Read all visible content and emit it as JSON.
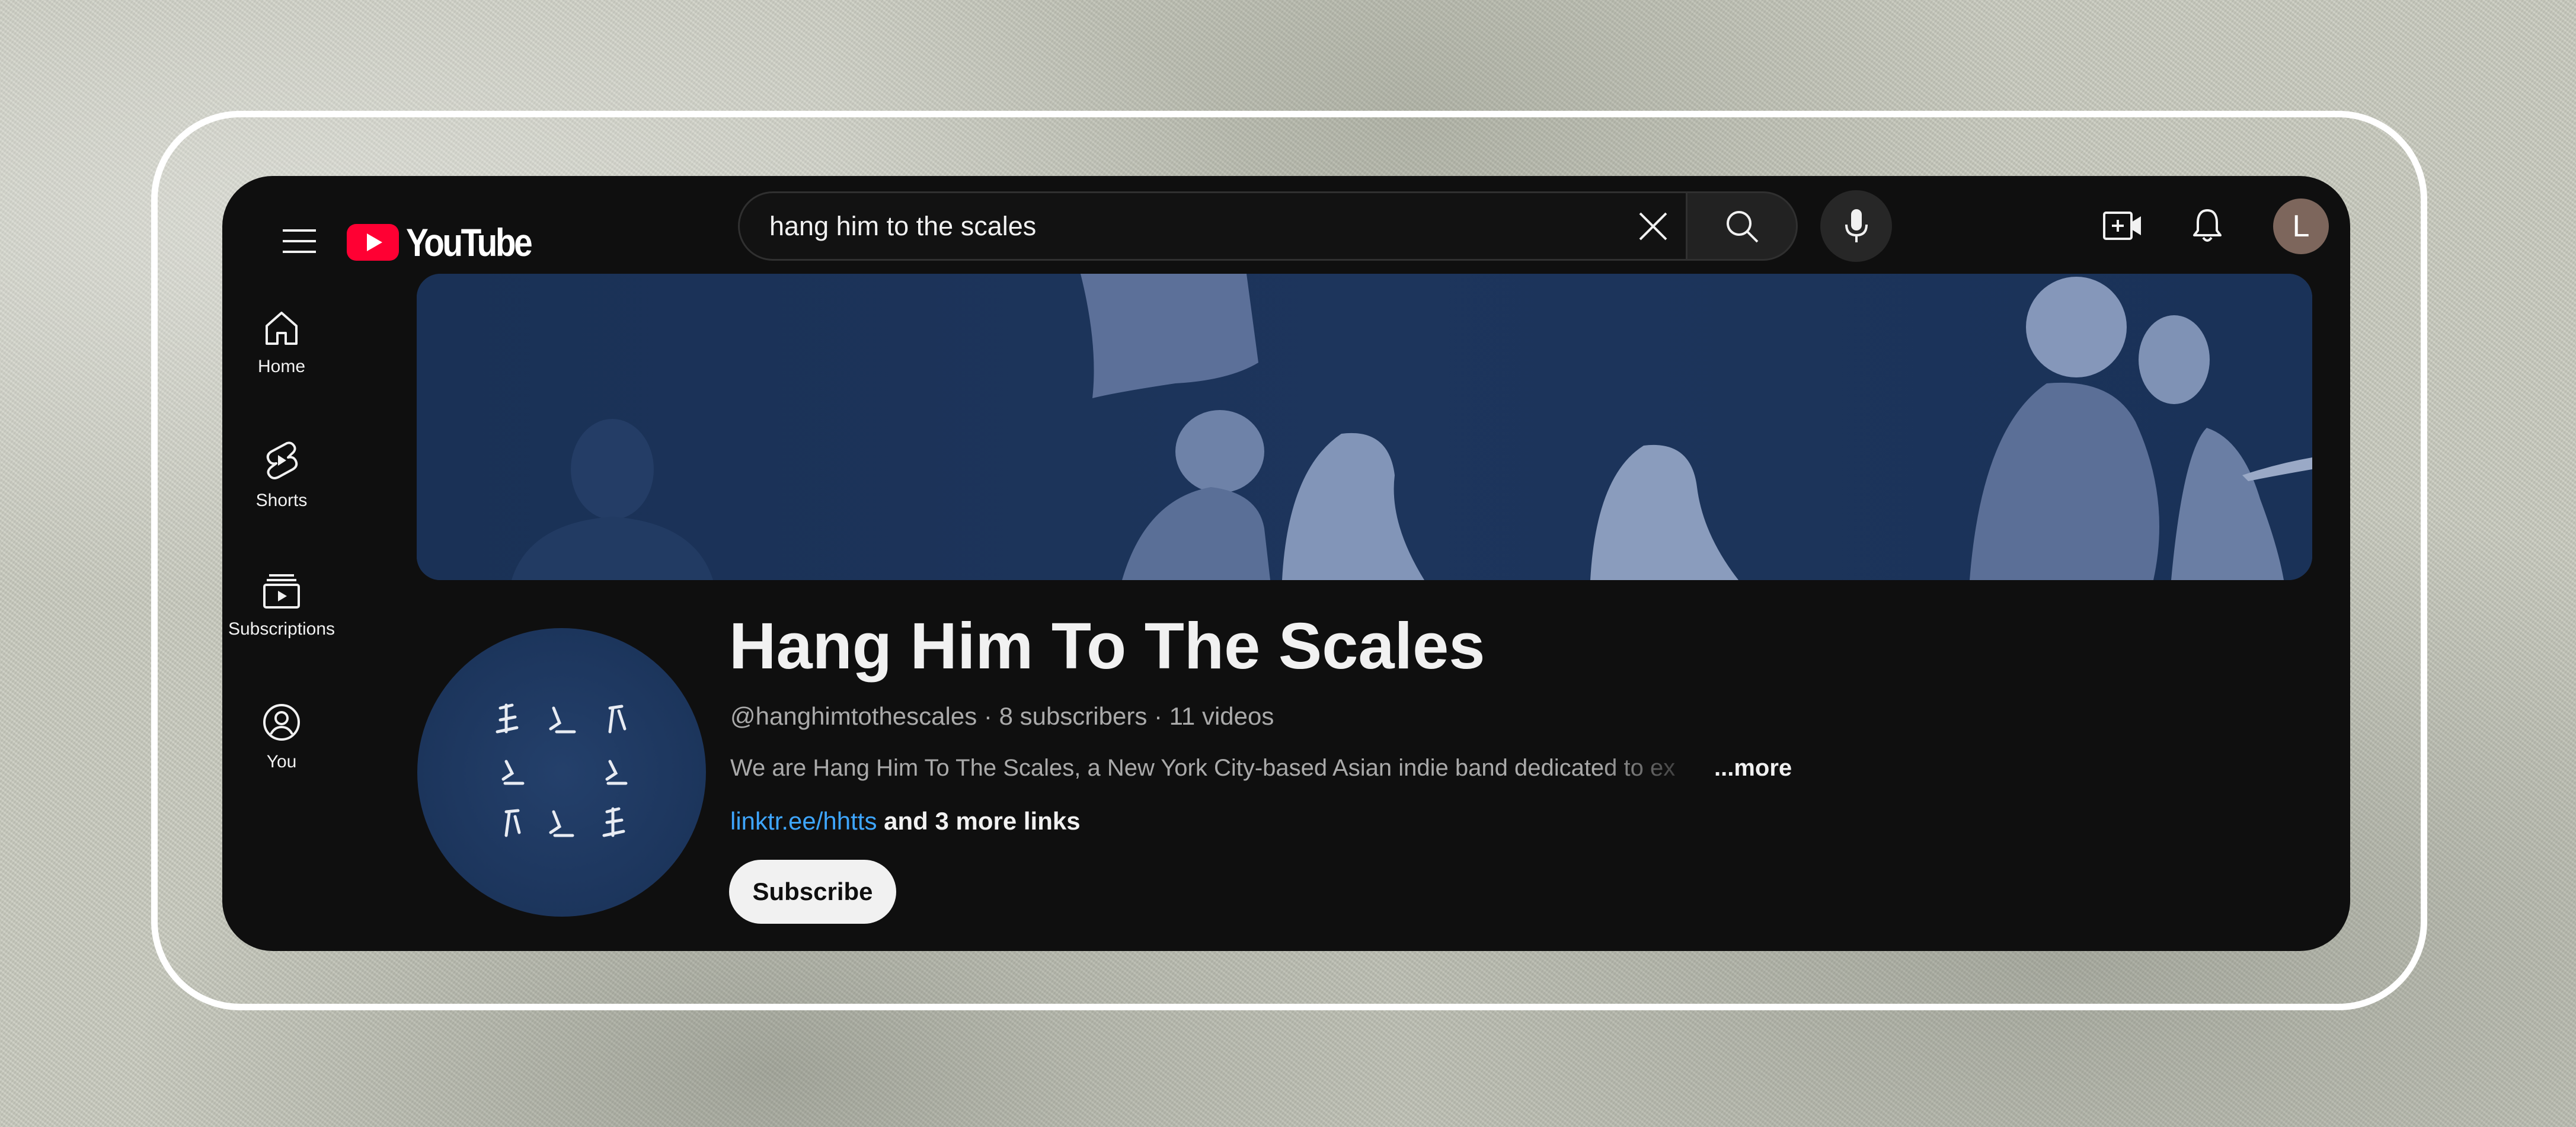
{
  "header": {
    "logo_text": "YouTube",
    "search": {
      "value": "hang him to the scales"
    },
    "avatar_letter": "L"
  },
  "sidebar": {
    "items": [
      {
        "label": "Home",
        "icon": "home-icon"
      },
      {
        "label": "Shorts",
        "icon": "shorts-icon"
      },
      {
        "label": "Subscriptions",
        "icon": "subscriptions-icon"
      },
      {
        "label": "You",
        "icon": "you-icon"
      }
    ]
  },
  "channel": {
    "title": "Hang Him To The Scales",
    "handle": "@hanghimtothescales",
    "subscribers": "8 subscribers",
    "videos": "11 videos",
    "description": "We are Hang Him To The Scales, a New York City-based Asian indie band dedicated to ex",
    "more_label": "...more",
    "link_main": "linktr.ee/hhtts",
    "link_more": "and 3 more links",
    "subscribe_label": "Subscribe",
    "separator": "·"
  },
  "colors": {
    "background": "#0f0f0f",
    "brand_red": "#ff0033",
    "link_blue": "#3ea6ff",
    "banner_blue": "#1b3359",
    "avatar_bg": "#7d665c"
  }
}
